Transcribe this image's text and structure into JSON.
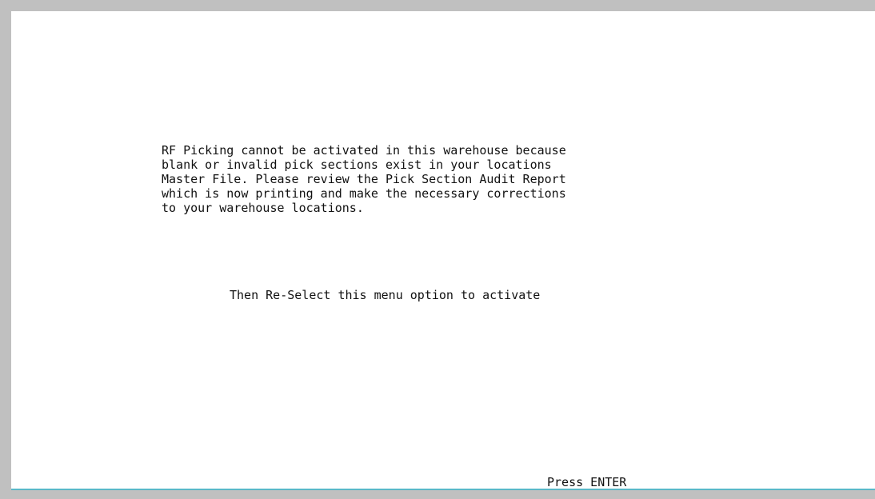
{
  "message": {
    "lines": [
      "RF Picking cannot be activated in this warehouse because",
      "blank or invalid pick sections exist in your locations",
      "Master File. Please review the Pick Section Audit Report",
      "which is now printing and make the necessary corrections",
      "to your warehouse locations."
    ]
  },
  "instruction": "Then Re-Select this menu option to activate",
  "prompt": "Press ENTER",
  "colors": {
    "frame": "#c0c0c0",
    "screen": "#ffffff",
    "bottom_rule": "#5ab8c8",
    "text": "#111111"
  }
}
